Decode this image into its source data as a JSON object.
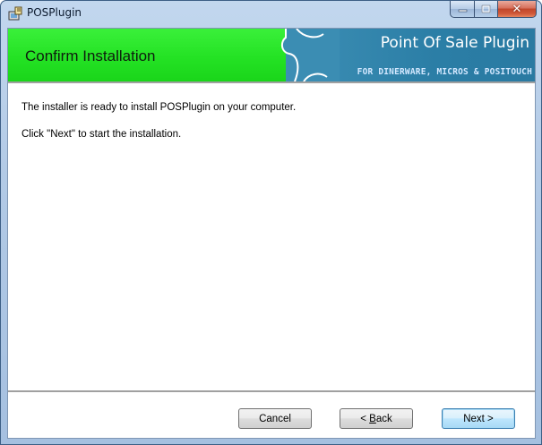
{
  "window": {
    "title": "POSPlugin"
  },
  "banner": {
    "heading": "Confirm Installation",
    "brand": "Point Of Sale Plugin",
    "tagline": "FOR DINERWARE, MICROS & POSITOUCH"
  },
  "body": {
    "line1": "The installer is ready to install POSPlugin on your computer.",
    "line2": "Click \"Next\" to start the installation."
  },
  "buttons": {
    "cancel": "Cancel",
    "back_prefix": "< ",
    "back_accel": "B",
    "back_rest": "ack",
    "next": "Next >"
  },
  "colors": {
    "banner_green": "#24e224",
    "banner_blue": "#2b7ea6",
    "close_red": "#c0462c"
  }
}
